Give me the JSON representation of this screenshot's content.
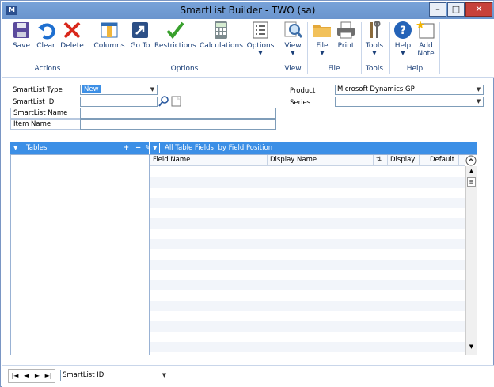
{
  "window": {
    "title": "SmartList Builder  -  TWO (sa)",
    "app_icon_text": "M",
    "minimize_glyph": "–",
    "maximize_glyph": "□",
    "close_glyph": "✕"
  },
  "ribbon": {
    "buttons": {
      "save": "Save",
      "clear": "Clear",
      "delete": "Delete",
      "columns": "Columns",
      "goto": "Go To",
      "restrictions": "Restrictions",
      "calculations": "Calculations",
      "options": "Options",
      "view": "View",
      "file": "File",
      "print": "Print",
      "tools": "Tools",
      "help": "Help",
      "add_note": "Add\nNote"
    },
    "groups": {
      "actions": "Actions",
      "options": "Options",
      "view": "View",
      "file": "File",
      "tools": "Tools",
      "help": "Help"
    }
  },
  "form": {
    "smartlist_type_label": "SmartList Type",
    "smartlist_type_value": "New",
    "smartlist_id_label": "SmartList ID",
    "smartlist_id_value": "",
    "smartlist_name_label": "SmartList Name",
    "smartlist_name_value": "",
    "item_name_label": "Item Name",
    "item_name_value": "",
    "product_label": "Product",
    "product_value": "Microsoft Dynamics GP",
    "series_label": "Series",
    "series_value": ""
  },
  "tables_panel": {
    "title": "Tables",
    "add_glyph": "+",
    "remove_glyph": "−"
  },
  "fields_panel": {
    "title": "All Table Fields; by Field Position",
    "columns": [
      "Field Name",
      "Display Name",
      "Display",
      "Default"
    ]
  },
  "footer": {
    "sort_value": "SmartList ID",
    "nav_first": "|◄",
    "nav_prev": "◄",
    "nav_next": "►",
    "nav_last": "►|"
  },
  "colors": {
    "title_bar": "#6a94cd",
    "panel_header": "#3c8fe6",
    "selection": "#3c8fe6",
    "ribbon_text": "#1a3f78"
  }
}
